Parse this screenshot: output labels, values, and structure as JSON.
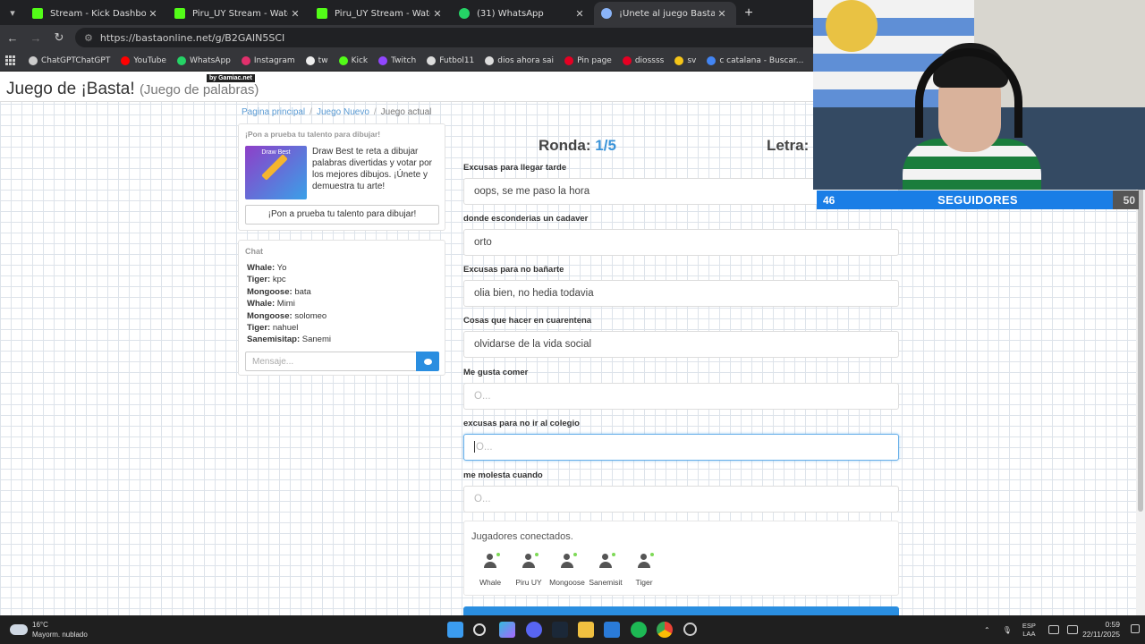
{
  "browser": {
    "tabs": [
      {
        "title": "Stream - Kick Dashboard",
        "favicon": "kick-icon",
        "active": false
      },
      {
        "title": "Piru_UY Stream - Watch Live on",
        "favicon": "kick-icon",
        "active": false
      },
      {
        "title": "Piru_UY Stream - Watch Live on",
        "favicon": "kick-icon",
        "active": false
      },
      {
        "title": "(31) WhatsApp",
        "favicon": "whatsapp-icon",
        "active": false
      },
      {
        "title": "¡Únete al juego Basta!",
        "favicon": "basta-icon",
        "active": true
      }
    ],
    "url": "https://bastaonline.net/g/B2GAIN5SCI",
    "bookmarks": [
      {
        "label": "ChatGPTChatGPT",
        "color": "#cccccc"
      },
      {
        "label": "YouTube",
        "color": "#ff0000"
      },
      {
        "label": "WhatsApp",
        "color": "#25d366"
      },
      {
        "label": "Instagram",
        "color": "#e1306c"
      },
      {
        "label": "tw",
        "color": "#eeeeee"
      },
      {
        "label": "Kick",
        "color": "#53fc18"
      },
      {
        "label": "Twitch",
        "color": "#9146ff"
      },
      {
        "label": "Futbol11",
        "color": "#dddddd"
      },
      {
        "label": "dios ahora sai",
        "color": "#dddddd"
      },
      {
        "label": "Pin page",
        "color": "#e60023"
      },
      {
        "label": "diossss",
        "color": "#e60023"
      },
      {
        "label": "sv",
        "color": "#f5c518"
      },
      {
        "label": "c catalana - Buscar...",
        "color": "#4285f4"
      }
    ]
  },
  "header": {
    "title": "Juego de ¡Basta!",
    "subtitle": "(Juego de palabras)",
    "badge": "by Gamiac.net"
  },
  "breadcrumb": {
    "home": "Pagina principal",
    "new_game": "Juego Nuevo",
    "current": "Juego actual"
  },
  "promo": {
    "heading": "¡Pon a prueba tu talento para dibujar!",
    "thumb_label": "Draw Best",
    "text": "Draw Best te reta a dibujar palabras divertidas y votar por los mejores dibujos. ¡Únete y demuestra tu arte!",
    "button": "¡Pon a prueba tu talento para dibujar!"
  },
  "chat": {
    "heading": "Chat",
    "messages": [
      {
        "user": "Whale:",
        "text": "Yo"
      },
      {
        "user": "Tiger:",
        "text": "kpc"
      },
      {
        "user": "Mongoose:",
        "text": "bata"
      },
      {
        "user": "Whale:",
        "text": "Mimi"
      },
      {
        "user": "Mongoose:",
        "text": "solomeo"
      },
      {
        "user": "Tiger:",
        "text": "nahuel"
      },
      {
        "user": "Sanemisitap:",
        "text": "Sanemi"
      }
    ],
    "input_placeholder": "Mensaje..."
  },
  "game": {
    "round_label": "Ronda:",
    "round_value": "1/5",
    "letter_label": "Letra:",
    "categories": [
      {
        "label": "Excusas para llegar tarde",
        "answer": "oops, se me paso la hora",
        "placeholder": ""
      },
      {
        "label": "donde esconderias un cadaver",
        "answer": "orto",
        "placeholder": ""
      },
      {
        "label": "Excusas para no bañarte",
        "answer": "olia bien, no hedia todavia",
        "placeholder": ""
      },
      {
        "label": "Cosas que hacer en cuarentena",
        "answer": "olvidarse de la vida social",
        "placeholder": ""
      },
      {
        "label": "Me gusta comer",
        "answer": "",
        "placeholder": "O..."
      },
      {
        "label": "excusas para no ir al colegio",
        "answer": "",
        "placeholder": "O..."
      },
      {
        "label": "me molesta cuando",
        "answer": "",
        "placeholder": "O..."
      }
    ],
    "players_heading": "Jugadores conectados.",
    "players": [
      "Whale",
      "Piru UY",
      "Mongoose",
      "Sanemisit",
      "Tiger"
    ]
  },
  "overlay": {
    "followers_current": "46",
    "followers_label": "SEGUIDORES",
    "followers_goal": "50",
    "progress": 0.92
  },
  "taskbar": {
    "temperature": "16°C",
    "weather": "Mayorm. nublado",
    "lang_top": "ESP",
    "lang_bottom": "LAA",
    "time": "0:59",
    "date": "22/11/2025"
  }
}
